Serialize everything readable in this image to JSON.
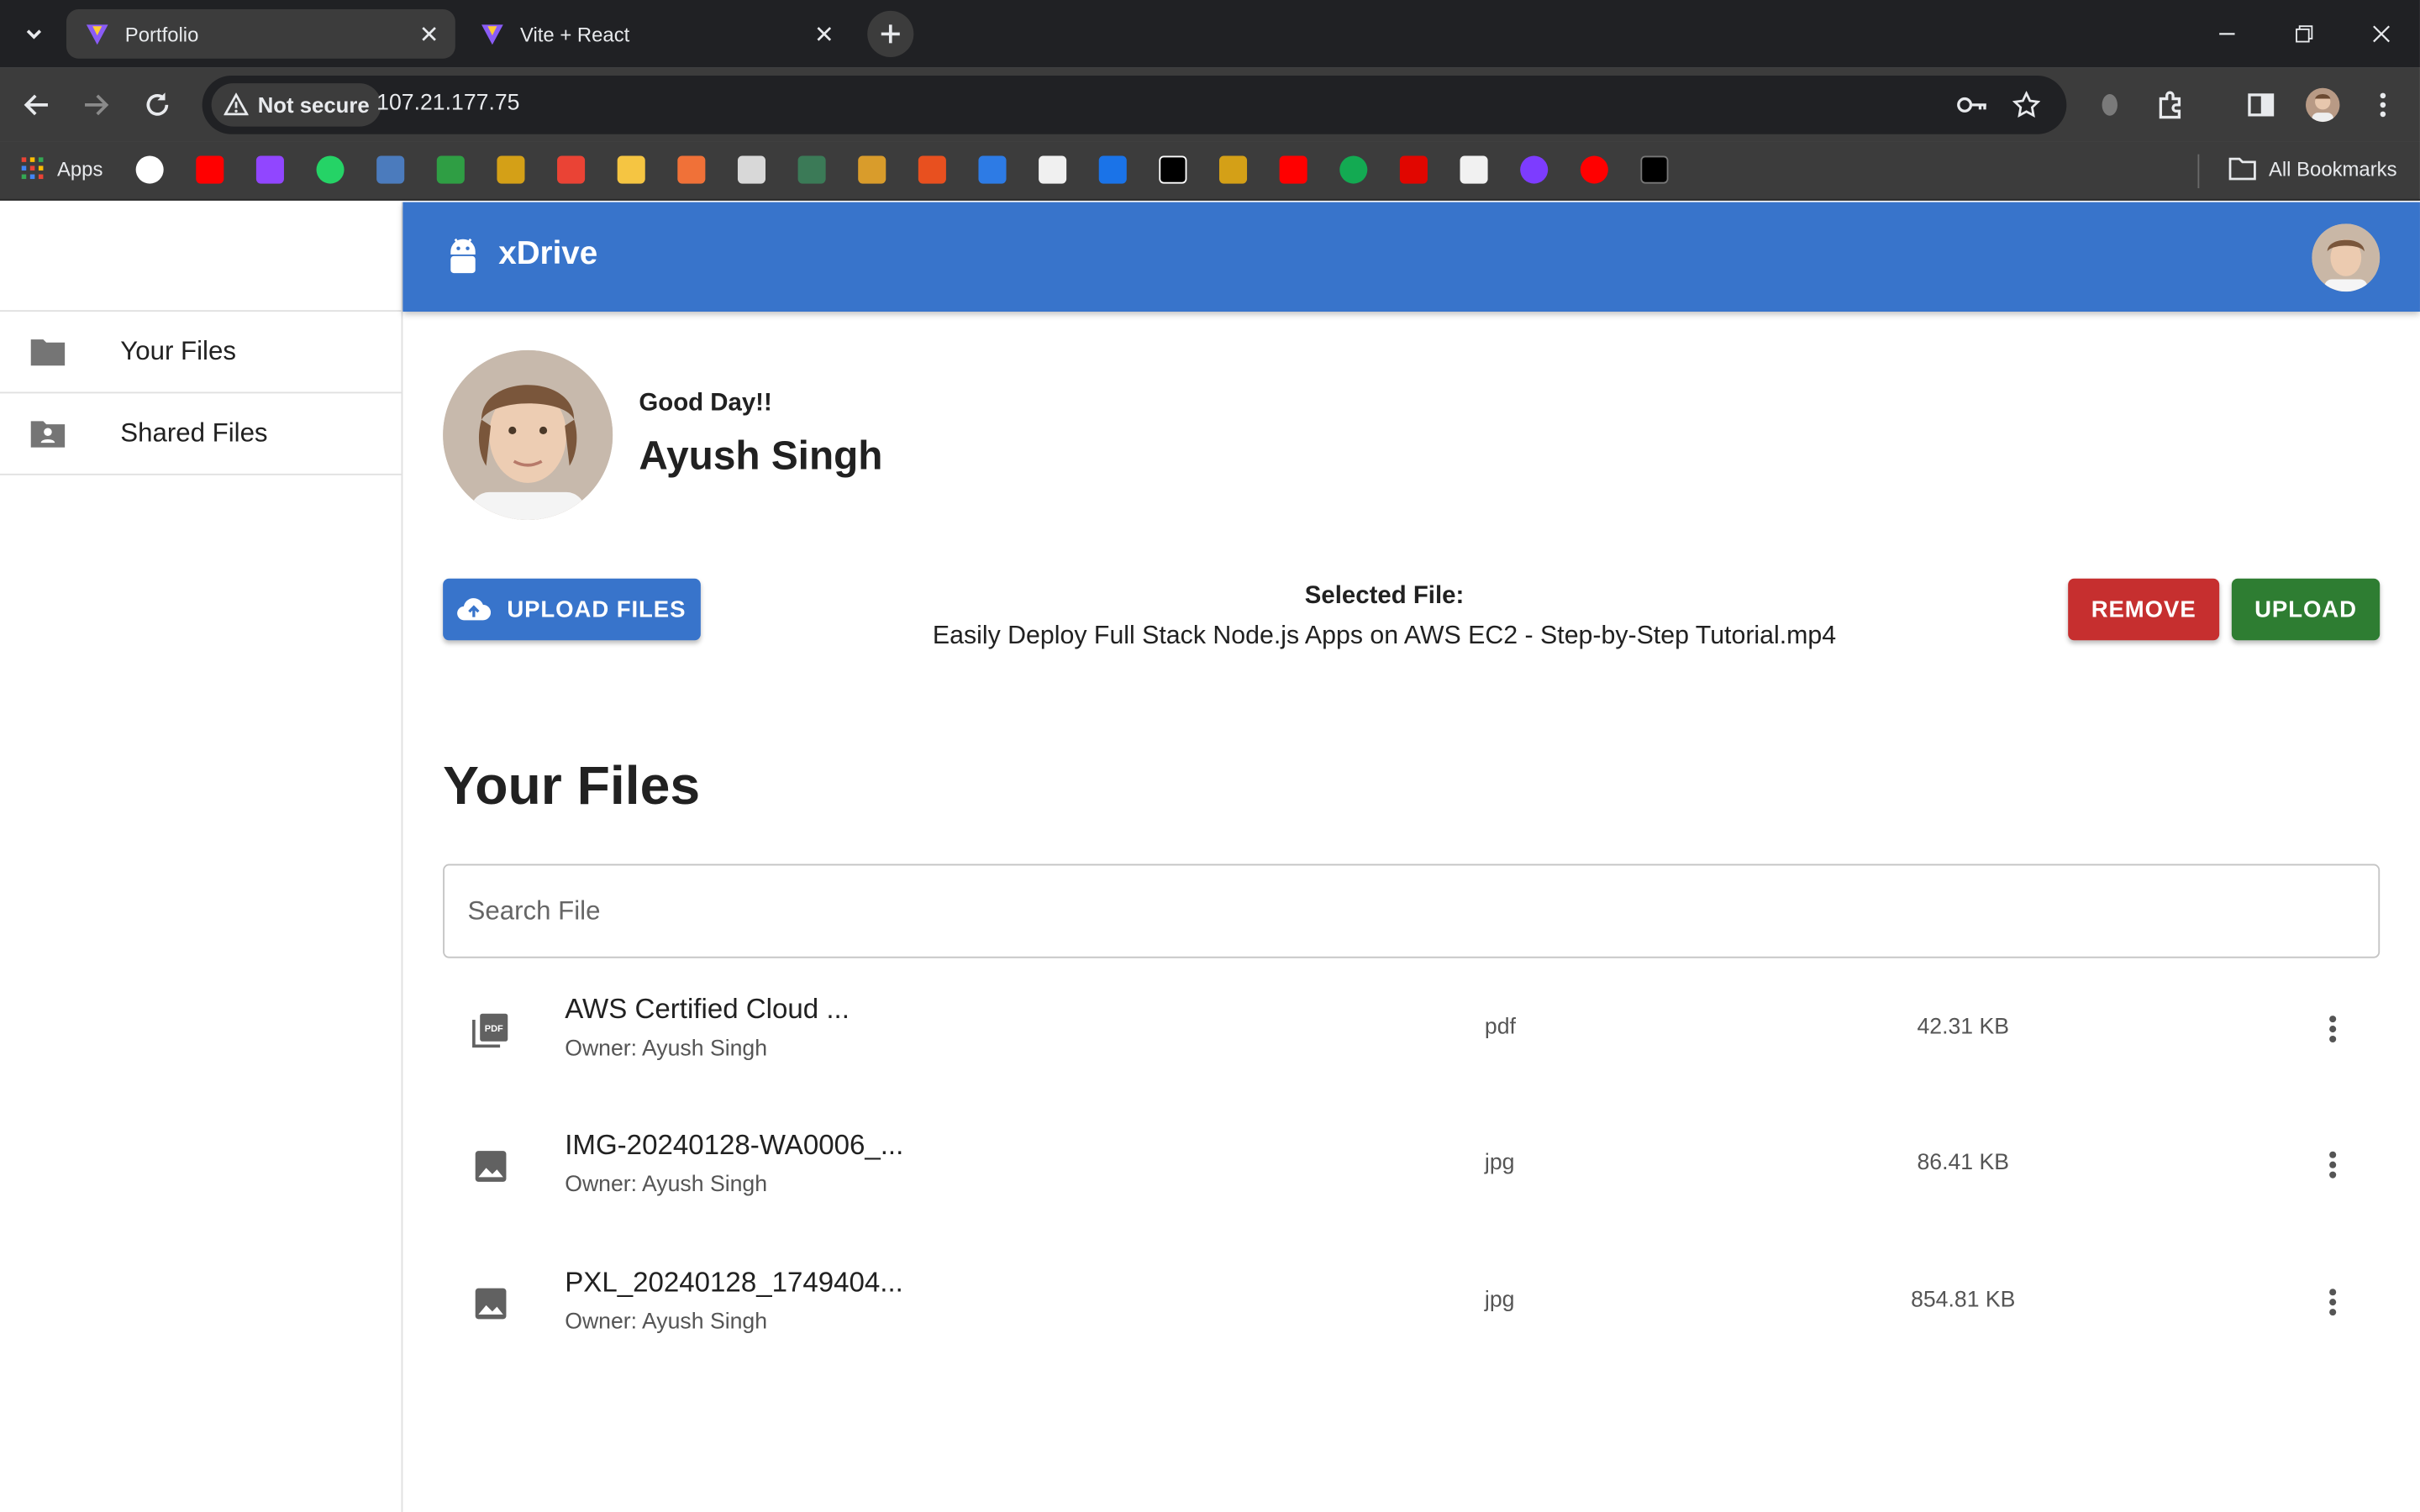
{
  "browser": {
    "tabs": [
      {
        "title": "Portfolio",
        "active": true
      },
      {
        "title": "Vite + React",
        "active": false
      }
    ],
    "security_label": "Not secure",
    "url": "107.21.177.75",
    "bookmarks": {
      "apps_label": "Apps",
      "all_label": "All Bookmarks",
      "icons": [
        "google-icon",
        "youtube-icon",
        "twitch-icon",
        "whatsapp-icon",
        "bookmark-icon",
        "bookmark-icon",
        "bookmark-icon",
        "gmail-icon",
        "bookmark-icon",
        "bookmark-icon",
        "bookmark-icon",
        "bookmark-icon",
        "bookmark-icon",
        "x-icon",
        "bookmark-icon",
        "bookmark-icon",
        "bookmark-icon",
        "x-twitter-icon",
        "bookmark-icon",
        "youtube-icon",
        "mongodb-icon",
        "f1-icon",
        "bookmark-icon",
        "bookmark-icon",
        "youtube-music-icon",
        "medium-icon"
      ]
    }
  },
  "app": {
    "brand": "xDrive",
    "sidebar": {
      "items": [
        {
          "label": "Your Files",
          "icon": "folder-icon"
        },
        {
          "label": "Shared Files",
          "icon": "shared-folder-icon"
        }
      ]
    },
    "profile": {
      "greeting": "Good Day!!",
      "name": "Ayush Singh"
    },
    "upload": {
      "upload_files_label": "UPLOAD FILES",
      "selected_label": "Selected File:",
      "selected_name": "Easily Deploy Full Stack Node.js Apps on AWS EC2 - Step-by-Step Tutorial.mp4",
      "remove_label": "REMOVE",
      "upload_label": "UPLOAD"
    },
    "files_section": {
      "title": "Your Files",
      "search_placeholder": "Search File",
      "files": [
        {
          "name": "AWS Certified Cloud ...",
          "owner": "Owner: Ayush Singh",
          "type": "pdf",
          "size": "42.31 KB",
          "icon": "pdf-icon"
        },
        {
          "name": "IMG-20240128-WA0006_...",
          "owner": "Owner: Ayush Singh",
          "type": "jpg",
          "size": "86.41 KB",
          "icon": "image-icon"
        },
        {
          "name": "PXL_20240128_1749404...",
          "owner": "Owner: Ayush Singh",
          "type": "jpg",
          "size": "854.81 KB",
          "icon": "image-icon"
        }
      ]
    }
  },
  "colors": {
    "primary": "#3874cb",
    "danger": "#c62f2f",
    "success": "#2e7d32",
    "chrome_dark": "#202124",
    "chrome_mid": "#3c3c3c"
  }
}
